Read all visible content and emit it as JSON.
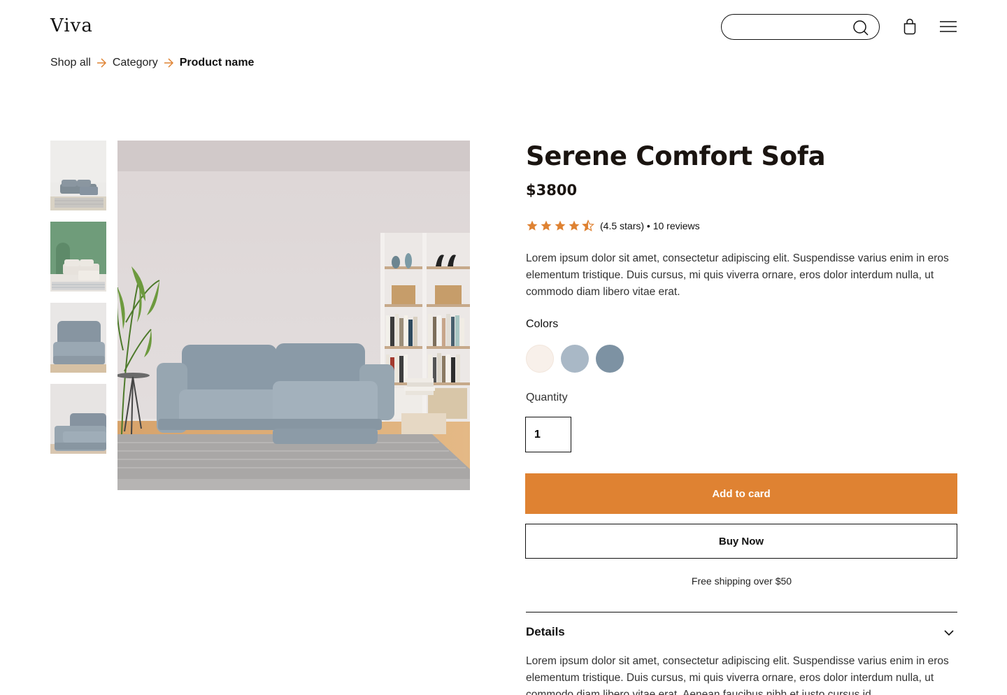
{
  "header": {
    "logo": "Viva",
    "search": {
      "placeholder": "",
      "value": "",
      "icon": "search-icon"
    },
    "cart_icon": "shopping-bag-icon",
    "menu_icon": "hamburger-menu-icon"
  },
  "breadcrumb": {
    "items": [
      {
        "label": "Shop all"
      },
      {
        "label": "Category"
      },
      {
        "label": "Product name"
      }
    ],
    "separator_icon": "arrow-right-icon"
  },
  "gallery": {
    "thumbnail_count": 4,
    "selected_index": 0
  },
  "product": {
    "title": "Serene Comfort Sofa",
    "price": "$3800",
    "rating": {
      "value": 4.5,
      "max": 5,
      "text": "(4.5 stars) • 10 reviews"
    },
    "description": "Lorem ipsum dolor sit amet, consectetur adipiscing elit. Suspendisse varius enim in eros elementum tristique. Duis cursus, mi quis viverra ornare, eros dolor interdum nulla, ut commodo diam libero vitae erat.",
    "colors_label": "Colors",
    "colors": [
      "#f8f0ea",
      "#a9b8c6",
      "#7d92a3"
    ],
    "quantity_label": "Quantity",
    "quantity": "1",
    "add_button": "Add to card",
    "buy_button": "Buy Now",
    "shipping_note": "Free shipping over $50",
    "details": {
      "title": "Details",
      "body": "Lorem ipsum dolor sit amet, consectetur adipiscing elit. Suspendisse varius enim in eros elementum tristique. Duis cursus, mi quis viverra ornare, eros dolor interdum nulla, ut commodo diam libero vitae erat. Aenean faucibus nibh et justo cursus id"
    }
  },
  "theme": {
    "accent": "#df8232",
    "text": "#111111"
  }
}
